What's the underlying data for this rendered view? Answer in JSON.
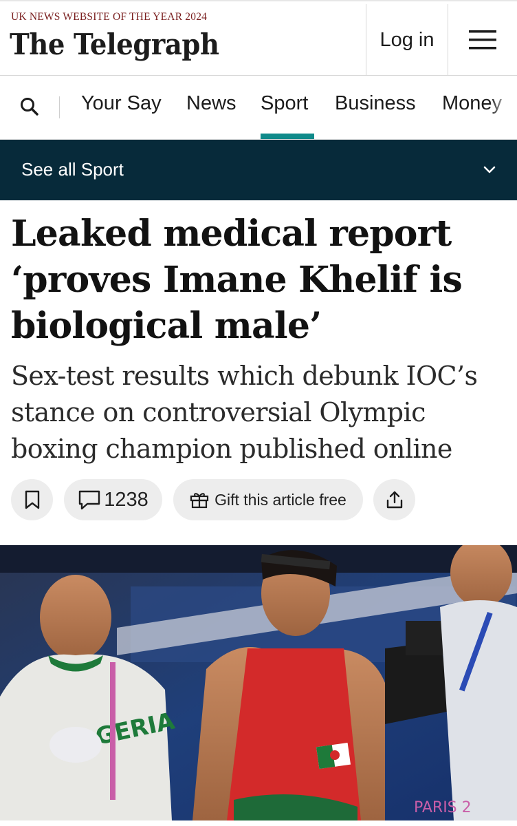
{
  "header": {
    "award": "UK NEWS WEBSITE OF THE YEAR 2024",
    "logo": "The Telegraph",
    "login_label": "Log in",
    "menu_icon": "hamburger-menu-icon"
  },
  "nav": {
    "search_icon": "search-icon",
    "items": [
      "Your Say",
      "News",
      "Sport",
      "Business",
      "Money"
    ],
    "active": "Sport",
    "accent_color": "#0f8a8a"
  },
  "section_bar": {
    "label": "See all Sport",
    "background": "#072a3a",
    "expand_icon": "chevron-down-icon"
  },
  "article": {
    "headline": "Leaked medical report ‘proves Imane Khelif is biological male’",
    "standfirst": "Sex-test results which debunk IOC’s stance on controversial Olympic boxing champion published online",
    "actions": {
      "bookmark_icon": "bookmark-icon",
      "comment_icon": "comment-icon",
      "comment_count": "1238",
      "gift_icon": "gift-icon",
      "gift_label": "Gift this article free",
      "share_icon": "share-icon"
    },
    "photo": {
      "alt": "Boxer in red vest celebrating in the ring with a coach in an Algeria shirt and a cameraman",
      "shirt_text": "ALGERIA",
      "board_text": "PARIS 2"
    }
  }
}
